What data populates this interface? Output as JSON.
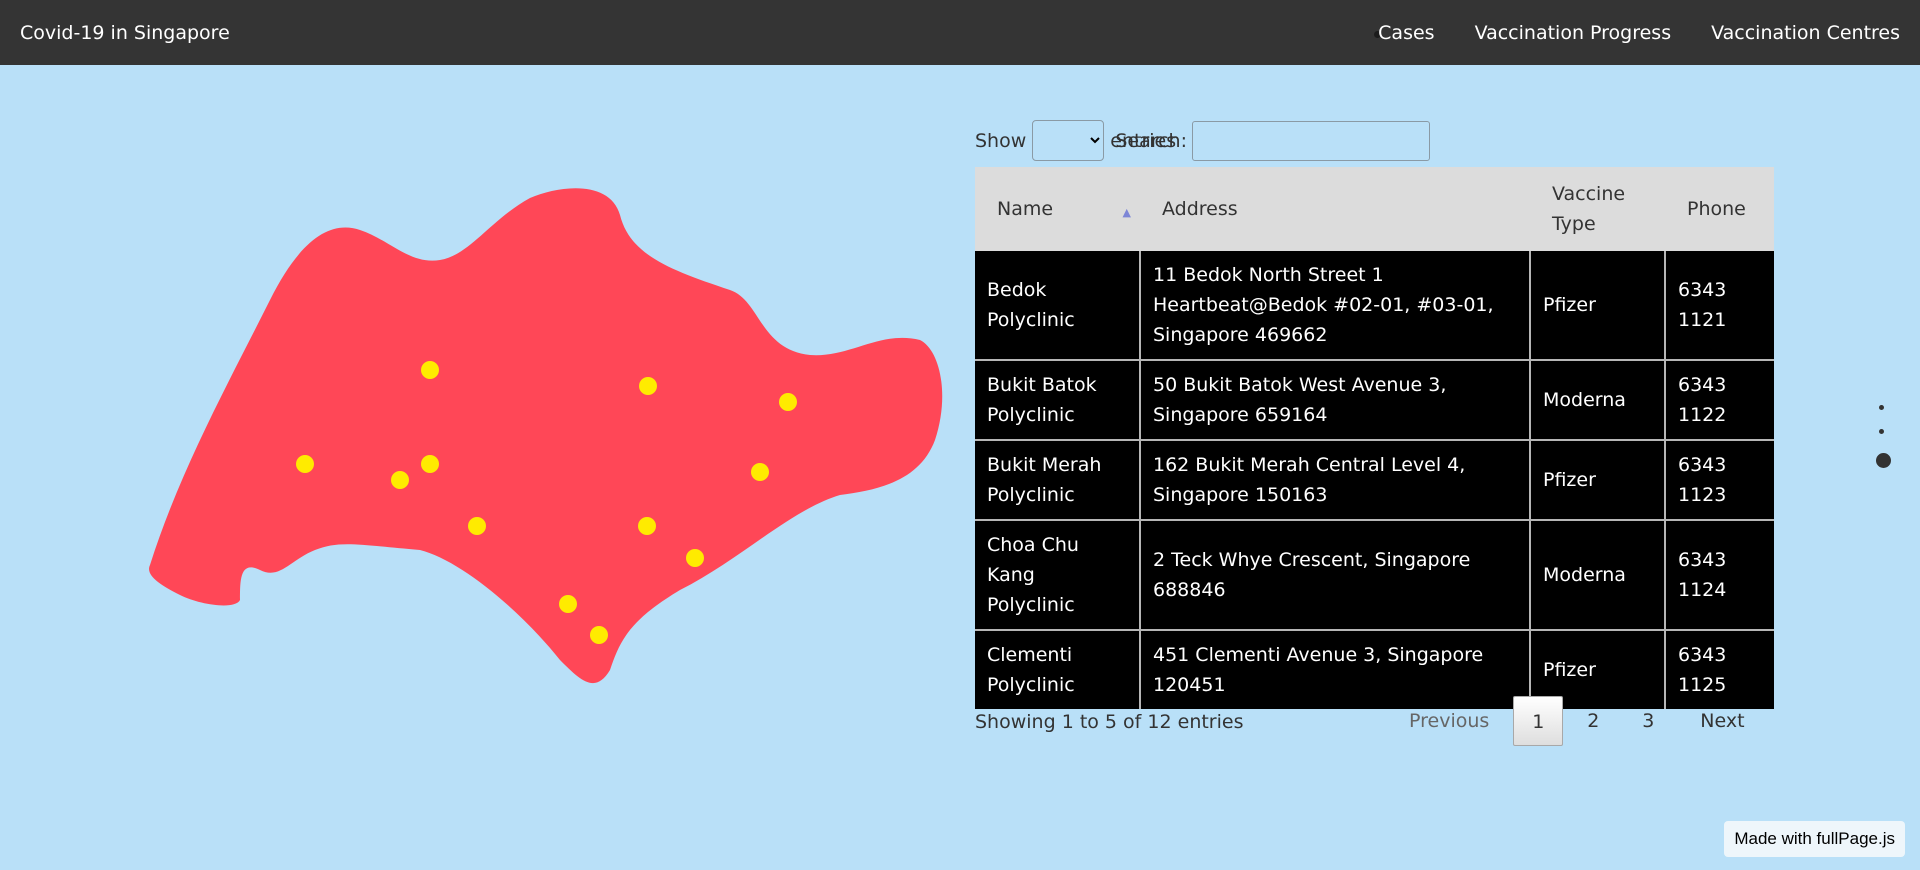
{
  "nav": {
    "brand": "Covid-19 in Singapore",
    "links": [
      "Cases",
      "Vaccination Progress",
      "Vaccination Centres"
    ]
  },
  "map": {
    "land_color": "#ff4757",
    "marker_color": "#ffeb00",
    "marker_count": 13
  },
  "table_controls": {
    "show_label": "Show",
    "entries_label": "entries",
    "length_selected": "",
    "search_label": "Search:",
    "search_value": ""
  },
  "table": {
    "columns": [
      "Name",
      "Address",
      "Vaccine Type",
      "Phone"
    ],
    "sorted_column": "Name",
    "rows": [
      {
        "name": "Bedok Polyclinic",
        "address": "11 Bedok North Street 1 Heartbeat@Bedok #02-01, #03-01, Singapore 469662",
        "vaccine": "Pfizer",
        "phone": "6343 1121"
      },
      {
        "name": "Bukit Batok Polyclinic",
        "address": "50 Bukit Batok West Avenue 3, Singapore 659164",
        "vaccine": "Moderna",
        "phone": "6343 1122"
      },
      {
        "name": "Bukit Merah Polyclinic",
        "address": "162 Bukit Merah Central Level 4, Singapore 150163",
        "vaccine": "Pfizer",
        "phone": "6343 1123"
      },
      {
        "name": "Choa Chu Kang Polyclinic",
        "address": "2 Teck Whye Crescent, Singapore 688846",
        "vaccine": "Moderna",
        "phone": "6343 1124"
      },
      {
        "name": "Clementi Polyclinic",
        "address": "451 Clementi Avenue 3, Singapore 120451",
        "vaccine": "Pfizer",
        "phone": "6343 1125"
      }
    ]
  },
  "info": "Showing 1 to 5 of 12 entries",
  "pagination": {
    "previous": "Previous",
    "pages": [
      "1",
      "2",
      "3"
    ],
    "current": "1",
    "next": "Next"
  },
  "section_nav": {
    "count": 3,
    "active_index": 2
  },
  "watermark": "Made with fullPage.js"
}
